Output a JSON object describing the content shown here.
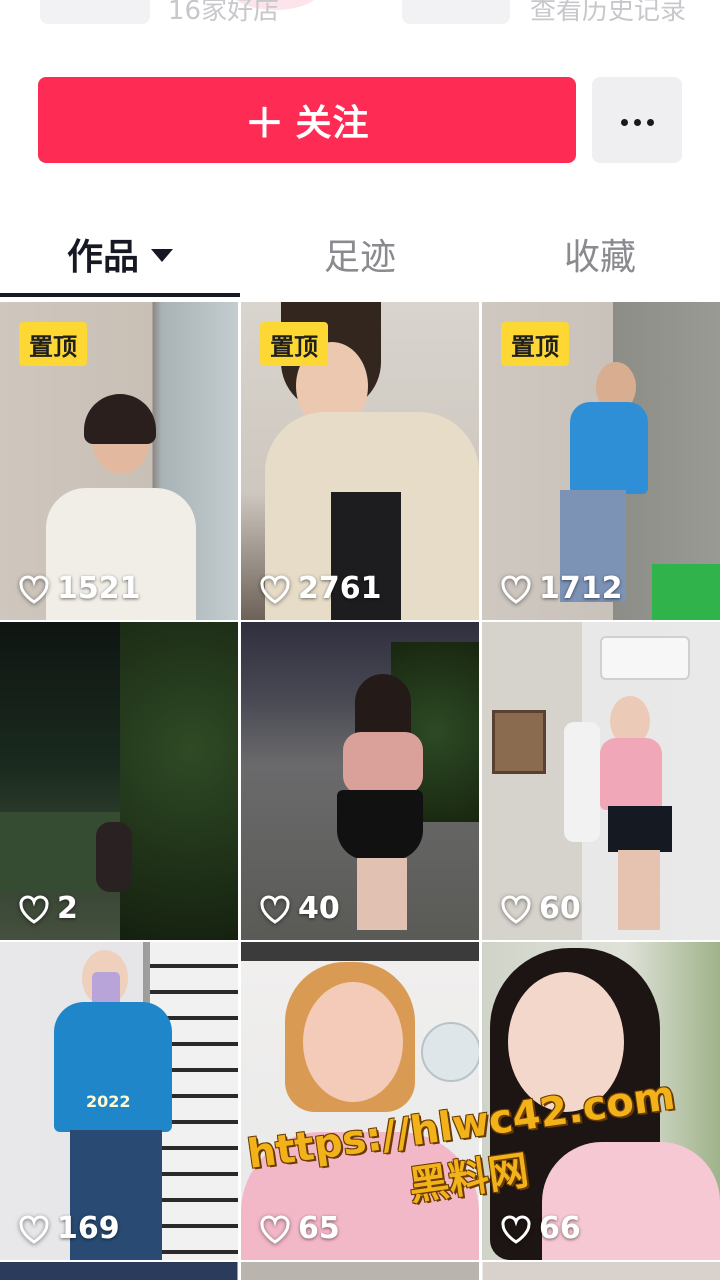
{
  "top_row": {
    "left_text": "16家好店",
    "right_text": "查看历史记录"
  },
  "actions": {
    "follow_label": "关注",
    "follow_icon": "plus-icon",
    "more_icon": "more-dots-icon"
  },
  "tabs": [
    {
      "label": "作品",
      "active": true,
      "has_dropdown": true
    },
    {
      "label": "足迹",
      "active": false
    },
    {
      "label": "收藏",
      "active": false
    }
  ],
  "pinned_label": "置顶",
  "videos": [
    {
      "likes": "1521",
      "pinned": true
    },
    {
      "likes": "2761",
      "pinned": true
    },
    {
      "likes": "1712",
      "pinned": true
    },
    {
      "likes": "2",
      "pinned": false
    },
    {
      "likes": "40",
      "pinned": false
    },
    {
      "likes": "60",
      "pinned": false
    },
    {
      "likes": "169",
      "pinned": false
    },
    {
      "likes": "65",
      "pinned": false
    },
    {
      "likes": "66",
      "pinned": false
    }
  ],
  "overlays": {
    "photo_text_1": "2022",
    "watermark_line1": "https://hlwc42.com",
    "watermark_line2": "黑料网"
  },
  "colors": {
    "accent": "#fe2c55",
    "pin_badge": "#fdd835",
    "watermark": "#f2b21a"
  }
}
